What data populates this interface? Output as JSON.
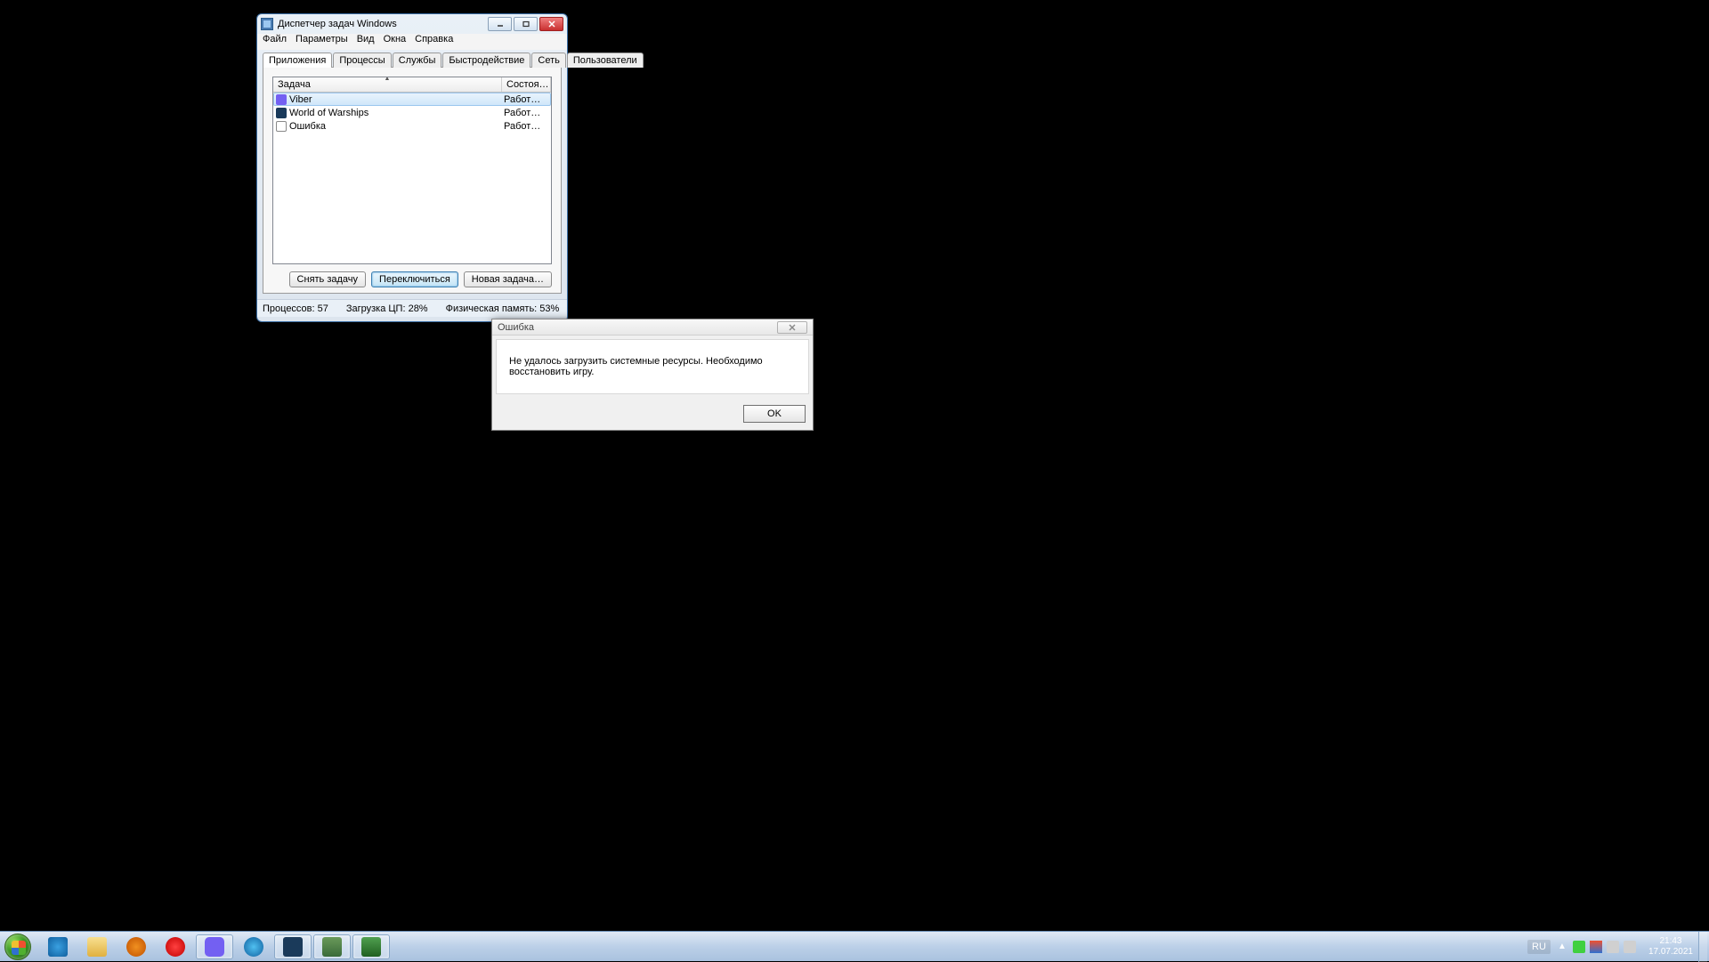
{
  "taskmgr": {
    "title": "Диспетчер задач Windows",
    "menu": {
      "file": "Файл",
      "options": "Параметры",
      "view": "Вид",
      "windows": "Окна",
      "help": "Справка"
    },
    "tabs": {
      "apps": "Приложения",
      "processes": "Процессы",
      "services": "Службы",
      "performance": "Быстродействие",
      "network": "Сеть",
      "users": "Пользователи"
    },
    "columns": {
      "task": "Задача",
      "state": "Состоя…"
    },
    "tasks": [
      {
        "name": "Viber",
        "state": "Работ…",
        "icon": "viber"
      },
      {
        "name": "World of Warships",
        "state": "Работ…",
        "icon": "wows"
      },
      {
        "name": "Ошибка",
        "state": "Работ…",
        "icon": "err"
      }
    ],
    "buttons": {
      "end": "Снять задачу",
      "switch": "Переключиться",
      "new": "Новая задача…"
    },
    "status": {
      "processes": "Процессов: 57",
      "cpu": "Загрузка ЦП: 28%",
      "mem": "Физическая память: 53%"
    }
  },
  "error_dialog": {
    "title": "Ошибка",
    "message": "Не удалось загрузить системные ресурсы. Необходимо восстановить игру.",
    "ok": "OK"
  },
  "taskbar": {
    "lang": "RU",
    "time": "21:43",
    "date": "17.07.2021"
  }
}
